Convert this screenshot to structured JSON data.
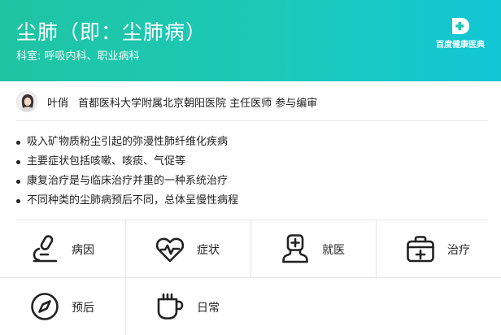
{
  "header": {
    "title": "尘肺（即：尘肺病）",
    "department": "科室: 呼吸内科、职业病科",
    "logo_text": "百度健康医典"
  },
  "author": {
    "name": "叶俏",
    "info": "首都医科大学附属北京朝阳医院 主任医师 参与编审"
  },
  "summary": [
    "吸入矿物质粉尘引起的弥漫性肺纤维化疾病",
    "主要症状包括咳嗽、咳痰、气促等",
    "康复治疗是与临床治疗并重的一种系统治疗",
    "不同种类的尘肺病预后不同，总体呈慢性病程"
  ],
  "nav": [
    {
      "label": "病因",
      "icon": "microscope-icon"
    },
    {
      "label": "症状",
      "icon": "heartbeat-icon"
    },
    {
      "label": "就医",
      "icon": "doctor-icon"
    },
    {
      "label": "治疗",
      "icon": "medical-kit-icon"
    },
    {
      "label": "预后",
      "icon": "compass-icon"
    },
    {
      "label": "日常",
      "icon": "cup-icon"
    }
  ],
  "colors": {
    "header_start": "#1fc4a3",
    "header_end": "#12c6d6",
    "text": "#222222",
    "divider": "#e6e6e6"
  }
}
